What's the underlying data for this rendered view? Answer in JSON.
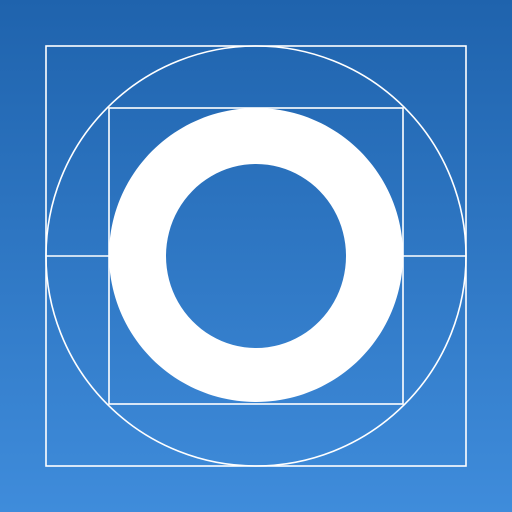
{
  "icon": {
    "name": "letter-o-construction-grid-icon",
    "colors": {
      "background_top": "#1f63ad",
      "background_bottom": "#3f8cdb",
      "guide_lines": "#ffffff",
      "glyph": "#ffffff"
    }
  }
}
